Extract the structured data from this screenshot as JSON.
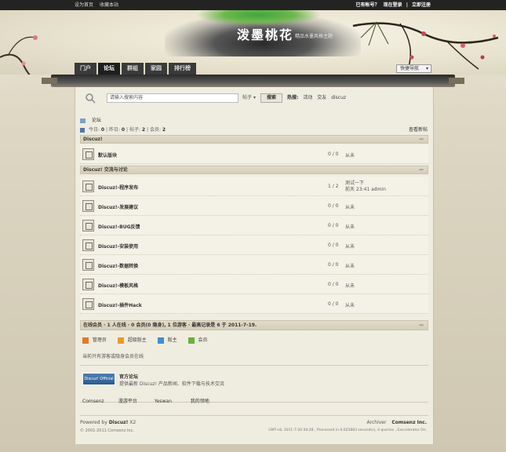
{
  "topbar": {
    "set_home": "设为首页",
    "bookmark": "收藏本站",
    "have_account": "已有帐号？",
    "login": "现在登录",
    "register": "立即注册",
    "sep": "|"
  },
  "banner": {
    "logo": "泼墨桃花",
    "subtitle": "精品水墨风格主题"
  },
  "nav": {
    "tabs": [
      {
        "label": "门户",
        "active": false
      },
      {
        "label": "论坛",
        "active": true
      },
      {
        "label": "群组",
        "active": false
      },
      {
        "label": "家园",
        "active": false
      },
      {
        "label": "排行榜",
        "active": false
      }
    ],
    "quick_nav": "快捷导航"
  },
  "search": {
    "placeholder": "请输入搜索内容",
    "type": "帖子",
    "type_arrow": "▾",
    "button": "搜索",
    "hot_label": "热搜:",
    "hot": [
      "活动",
      "交友",
      "discuz"
    ]
  },
  "breadcrumb": {
    "current": "论坛"
  },
  "stats": {
    "today_label": "今日:",
    "today": "0",
    "yesterday_label": "昨日:",
    "yesterday": "0",
    "posts_label": "帖子:",
    "posts": "2",
    "members_label": "会员:",
    "members": "2",
    "sep": "|",
    "new_posts": "查看新帖"
  },
  "categories": [
    {
      "title": "Discuz!",
      "forums": [
        {
          "name": "默认版块",
          "count": "0 / 0",
          "last": "从未"
        }
      ]
    },
    {
      "title": "Discuz! 交流与讨论",
      "forums": [
        {
          "name": "Discuz!-程序发布",
          "count": "1 / 2",
          "last": "测试一下",
          "last2": "前天 23:41 admin"
        },
        {
          "name": "Discuz!-发展建议",
          "count": "0 / 0",
          "last": "从未"
        },
        {
          "name": "Discuz!-BUG反馈",
          "count": "0 / 0",
          "last": "从未"
        },
        {
          "name": "Discuz!-安装使用",
          "count": "0 / 0",
          "last": "从未"
        },
        {
          "name": "Discuz!-数据转换",
          "count": "0 / 0",
          "last": "从未"
        },
        {
          "name": "Discuz!-模板风格",
          "count": "0 / 0",
          "last": "从未"
        },
        {
          "name": "Discuz!-插件Hack",
          "count": "0 / 0",
          "last": "从未"
        }
      ]
    }
  ],
  "collapse_symbol": "—",
  "online": {
    "header": "在线会员 · 1 人在线 · 0 会员(0 隐身), 1 位游客 · 最高记录是 6 于 2011-7-19.",
    "legend": [
      {
        "label": "管理员",
        "color": "#e07a2a"
      },
      {
        "label": "超级版主",
        "color": "#e89a2a"
      },
      {
        "label": "版主",
        "color": "#3f8fd0"
      },
      {
        "label": "会员",
        "color": "#6dae3c"
      }
    ],
    "text": "当前只有游客或隐身会员在线"
  },
  "links": {
    "logo": "Discuz! Official",
    "title": "官方论坛",
    "desc": "提供最新 Discuz! 产品新闻、软件下载与技术交流",
    "partners": [
      "Comsenz",
      "漫游平台",
      "Yeswan",
      "我的领地"
    ]
  },
  "footer": {
    "powered_prefix": "Powered by",
    "powered_name": "Discuz!",
    "powered_ver": "X2",
    "copyright": "© 2001-2011 Comsenz Inc.",
    "archiver": "Archiver",
    "company": "Comsenz Inc.",
    "gmt": "GMT+8, 2011-7-20 04:28 , Processed in 0.025883 second(s), 4 queries , Eaccelerator On."
  }
}
